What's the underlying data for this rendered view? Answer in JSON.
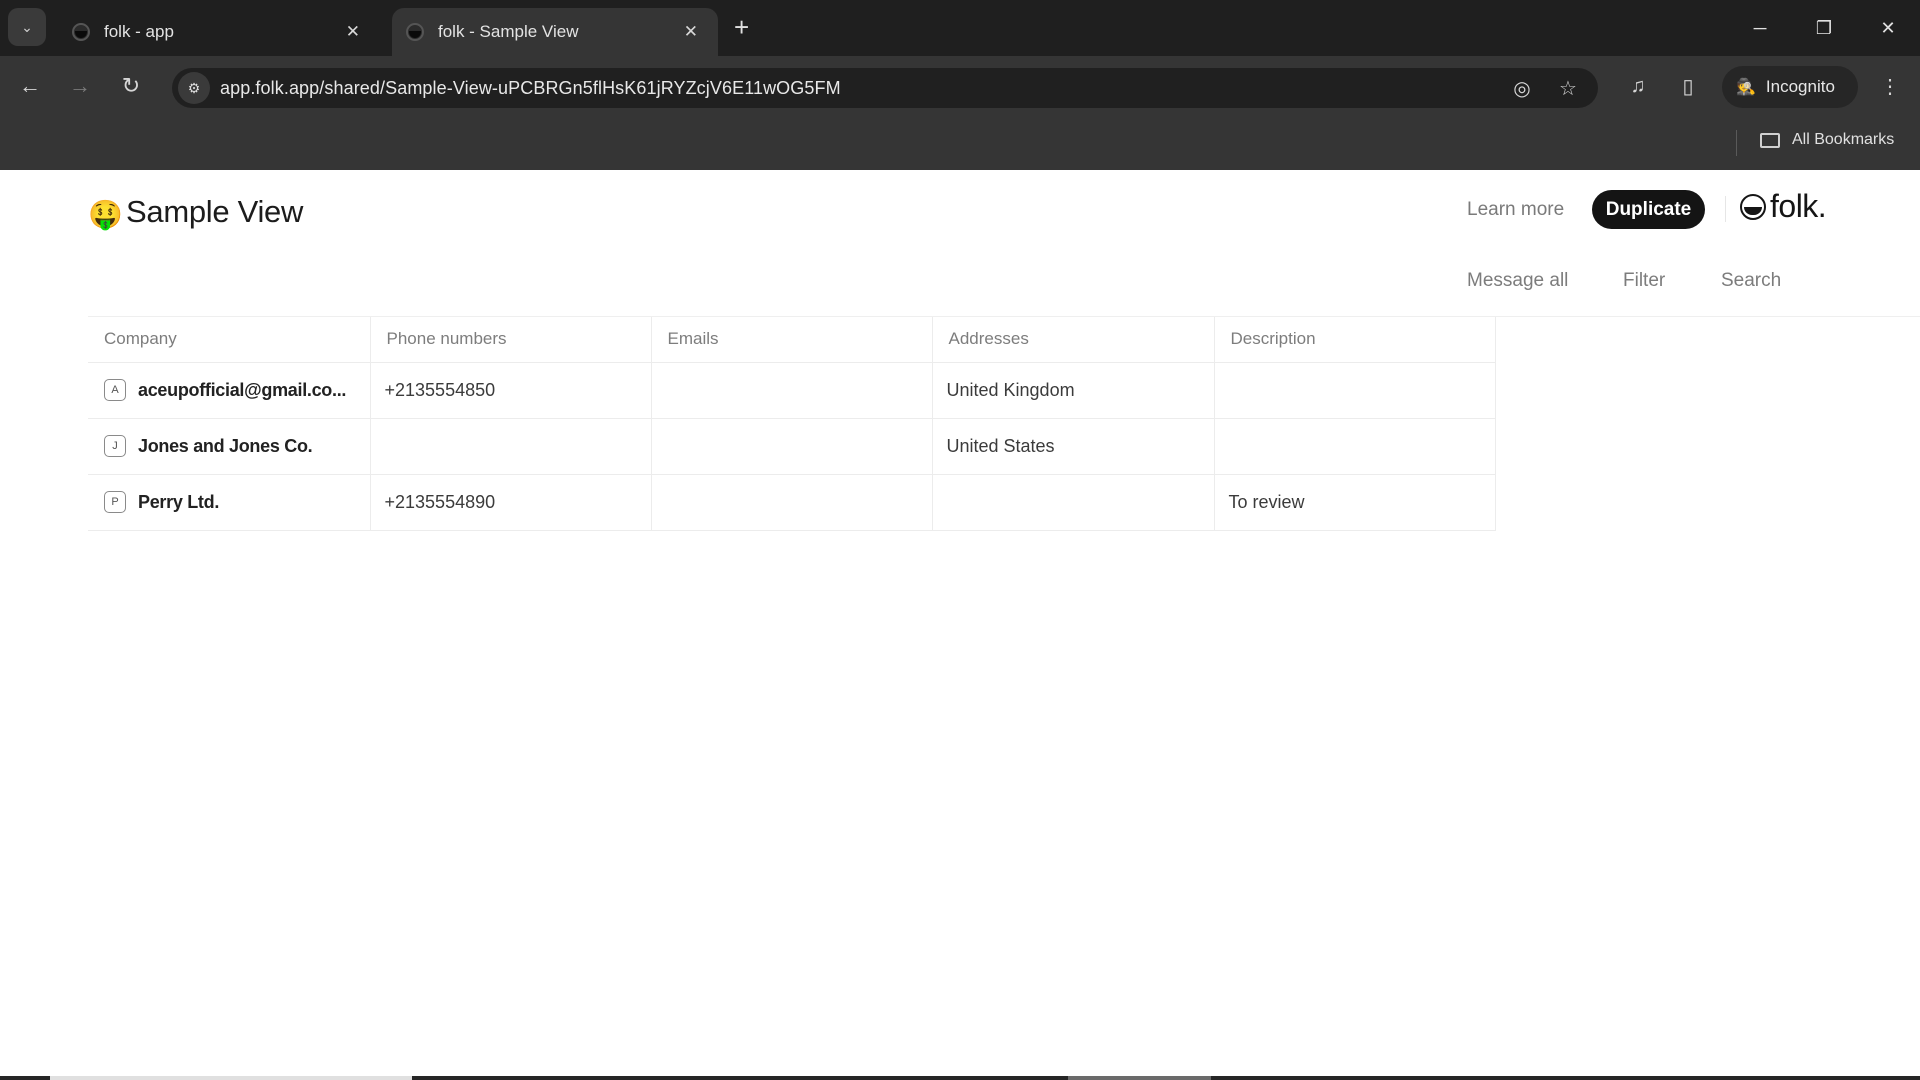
{
  "browser": {
    "tabs": [
      {
        "title": "folk - app",
        "active": false
      },
      {
        "title": "folk - Sample View",
        "active": true
      }
    ],
    "icons": {
      "tab_search": "⌄",
      "close": "✕",
      "new_tab": "+",
      "minimize": "─",
      "restore": "❐",
      "window_close": "✕",
      "back": "←",
      "forward": "→",
      "reload": "↻",
      "site_settings": "⚙",
      "eye_off": "◎",
      "star": "☆",
      "media": "♫",
      "side_panel": "▯",
      "incognito": "🕵",
      "menu": "⋮"
    },
    "url": "app.folk.app/shared/Sample-View-uPCBRGn5flHsK61jRYZcjV6E11wOG5FM",
    "profile_label": "Incognito",
    "bookmarks_label": "All Bookmarks"
  },
  "page": {
    "emoji": "🤑",
    "title": "Sample View",
    "learn_more": "Learn more",
    "duplicate": "Duplicate",
    "brand": "folk.",
    "actions": {
      "message_all": "Message all",
      "filter": "Filter",
      "search": "Search"
    },
    "table": {
      "columns": [
        "Company",
        "Phone numbers",
        "Emails",
        "Addresses",
        "Description"
      ],
      "rows": [
        {
          "initial": "A",
          "company": "aceupofficial@gmail.co...",
          "phone": "+2135554850",
          "email": "",
          "address": "United Kingdom",
          "description": ""
        },
        {
          "initial": "J",
          "company": "Jones and Jones Co.",
          "phone": "",
          "email": "",
          "address": "United States",
          "description": ""
        },
        {
          "initial": "P",
          "company": "Perry Ltd.",
          "phone": "+2135554890",
          "email": "",
          "address": "",
          "description": "To review"
        }
      ]
    }
  },
  "colors": {
    "chrome_bg": "#353535",
    "tabstrip_bg": "#1f1f1f",
    "primary_button": "#141414",
    "muted_text": "#7c7c7c"
  }
}
